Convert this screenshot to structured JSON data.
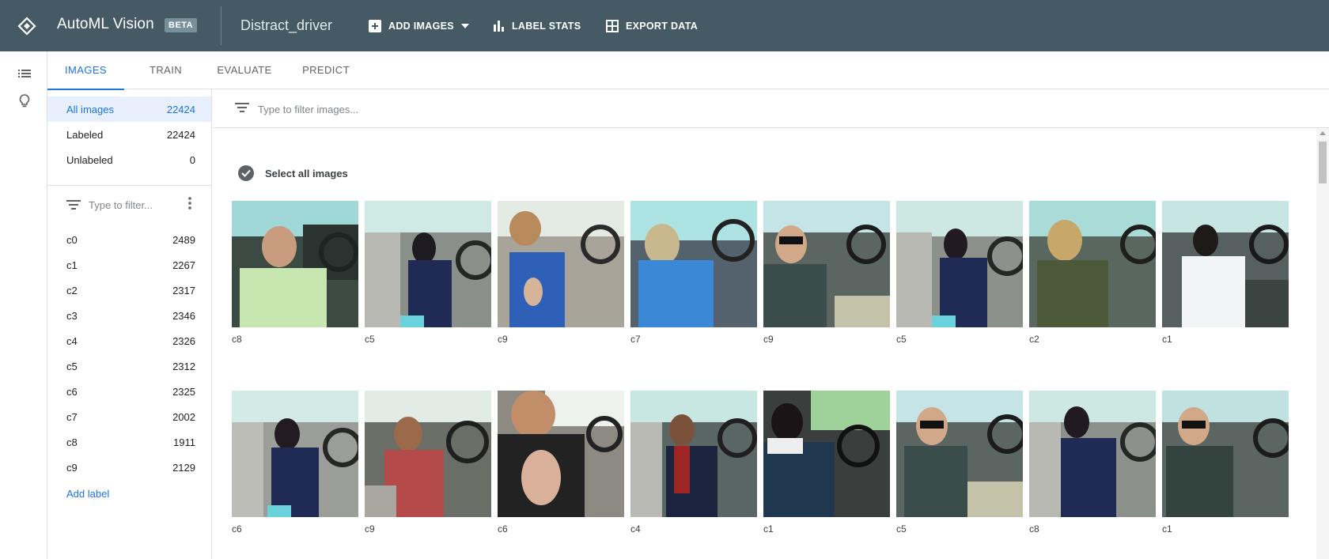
{
  "header": {
    "app_title": "AutoML Vision",
    "beta_badge": "BETA",
    "dataset_name": "Distract_driver",
    "add_images_label": "ADD IMAGES",
    "label_stats_label": "LABEL STATS",
    "export_data_label": "EXPORT DATA",
    "background_color": "#455a64"
  },
  "rail": {
    "icons": [
      "list-icon",
      "lightbulb-icon"
    ]
  },
  "tabs": [
    {
      "label": "IMAGES",
      "active": true
    },
    {
      "label": "TRAIN",
      "active": false
    },
    {
      "label": "EVALUATE",
      "active": false
    },
    {
      "label": "PREDICT",
      "active": false
    }
  ],
  "image_filters": [
    {
      "label": "All images",
      "count": "22424",
      "active": true
    },
    {
      "label": "Labeled",
      "count": "22424",
      "active": false
    },
    {
      "label": "Unlabeled",
      "count": "0",
      "active": false
    }
  ],
  "label_filter": {
    "placeholder": "Type to filter..."
  },
  "labels": [
    {
      "name": "c0",
      "count": "2489"
    },
    {
      "name": "c1",
      "count": "2267"
    },
    {
      "name": "c2",
      "count": "2317"
    },
    {
      "name": "c3",
      "count": "2346"
    },
    {
      "name": "c4",
      "count": "2326"
    },
    {
      "name": "c5",
      "count": "2312"
    },
    {
      "name": "c6",
      "count": "2325"
    },
    {
      "name": "c7",
      "count": "2002"
    },
    {
      "name": "c8",
      "count": "1911"
    },
    {
      "name": "c9",
      "count": "2129"
    }
  ],
  "add_label": "Add label",
  "search": {
    "placeholder": "Type to filter images..."
  },
  "select_all": "Select all images",
  "images": [
    {
      "label": "c8"
    },
    {
      "label": "c5"
    },
    {
      "label": "c9"
    },
    {
      "label": "c7"
    },
    {
      "label": "c9"
    },
    {
      "label": "c5"
    },
    {
      "label": "c2"
    },
    {
      "label": "c1"
    },
    {
      "label": "c6"
    },
    {
      "label": "c9"
    },
    {
      "label": "c6"
    },
    {
      "label": "c4"
    },
    {
      "label": "c1"
    },
    {
      "label": "c5"
    },
    {
      "label": "c8"
    },
    {
      "label": "c1"
    }
  ],
  "colors": {
    "accent": "#1a73e8",
    "active_bg": "#e8f0fe"
  }
}
